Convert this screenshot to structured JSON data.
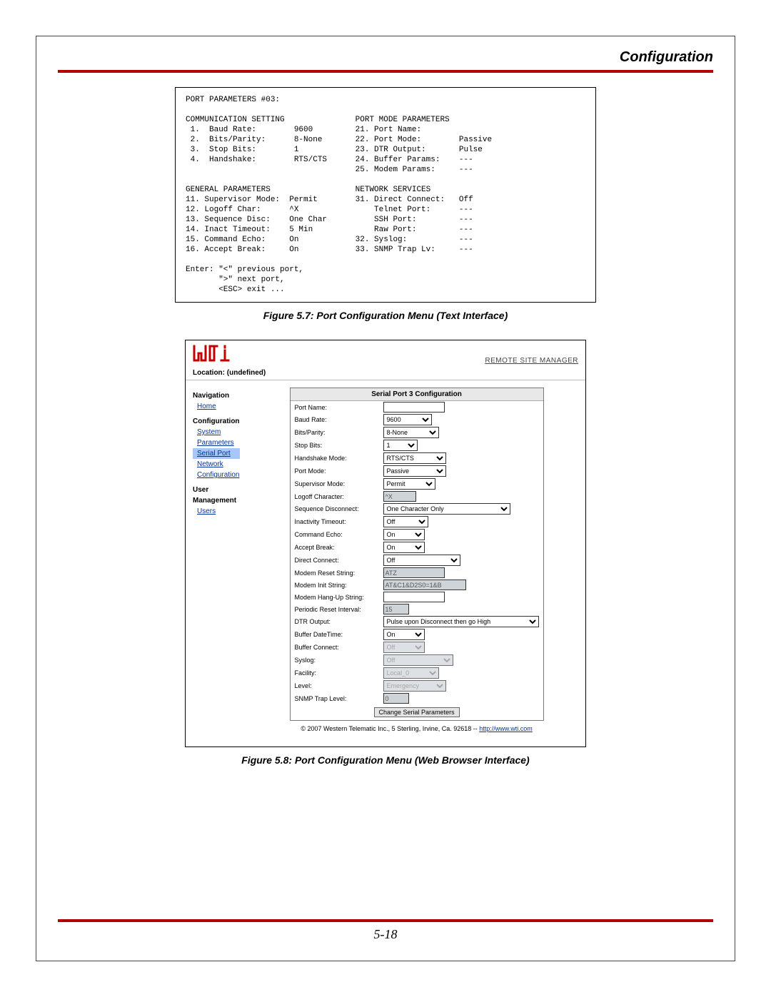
{
  "page": {
    "header": "Configuration",
    "page_number": "5-18"
  },
  "figure7": {
    "caption": "Figure 5.7:  Port Configuration Menu (Text Interface)",
    "title": "PORT PARAMETERS #03:",
    "communication_setting": {
      "heading": "COMMUNICATION SETTING",
      "items": [
        {
          "num": "1.",
          "label": "Baud Rate:",
          "value": "9600"
        },
        {
          "num": "2.",
          "label": "Bits/Parity:",
          "value": "8-None"
        },
        {
          "num": "3.",
          "label": "Stop Bits:",
          "value": "1"
        },
        {
          "num": "4.",
          "label": "Handshake:",
          "value": "RTS/CTS"
        }
      ]
    },
    "port_mode_parameters": {
      "heading": "PORT MODE PARAMETERS",
      "items": [
        {
          "num": "21.",
          "label": "Port Name:",
          "value": ""
        },
        {
          "num": "22.",
          "label": "Port Mode:",
          "value": "Passive"
        },
        {
          "num": "23.",
          "label": "DTR Output:",
          "value": "Pulse"
        },
        {
          "num": "24.",
          "label": "Buffer Params:",
          "value": "---"
        },
        {
          "num": "25.",
          "label": "Modem Params:",
          "value": "---"
        }
      ]
    },
    "general_parameters": {
      "heading": "GENERAL PARAMETERS",
      "items": [
        {
          "num": "11.",
          "label": "Supervisor Mode:",
          "value": "Permit"
        },
        {
          "num": "12.",
          "label": "Logoff Char:",
          "value": "^X"
        },
        {
          "num": "13.",
          "label": "Sequence Disc:",
          "value": "One Char"
        },
        {
          "num": "14.",
          "label": "Inact Timeout:",
          "value": "5 Min"
        },
        {
          "num": "15.",
          "label": "Command Echo:",
          "value": "On"
        },
        {
          "num": "16.",
          "label": "Accept Break:",
          "value": "On"
        }
      ]
    },
    "network_services": {
      "heading": "NETWORK SERVICES",
      "items": [
        {
          "num": "31.",
          "label": "Direct Connect:",
          "value": "Off"
        },
        {
          "num": "",
          "label": "Telnet Port:",
          "value": "---"
        },
        {
          "num": "",
          "label": "SSH Port:",
          "value": "---"
        },
        {
          "num": "",
          "label": "Raw Port:",
          "value": "---"
        },
        {
          "num": "32.",
          "label": "Syslog:",
          "value": "---"
        },
        {
          "num": "33.",
          "label": "SNMP Trap Lv:",
          "value": "---"
        }
      ]
    },
    "footer_lines": [
      "Enter: \"<\" previous port,",
      "       \">\" next port,",
      "       <ESC> exit ..."
    ]
  },
  "figure8": {
    "caption": "Figure 5.8:  Port Configuration Menu (Web Browser Interface)",
    "remote_site_manager": "REMOTE SITE MANAGER",
    "location_label": "Location: (undefined)",
    "nav": {
      "navigation_heading": "Navigation",
      "home": "Home",
      "config_heading": "Configuration",
      "system_parameters": "System Parameters",
      "serial_port": "Serial Port",
      "network_configuration": "Network Configuration",
      "user_mgmt_heading": "User Management",
      "users": "Users"
    },
    "formtitle": "Serial Port 3 Configuration",
    "fields": {
      "port_name": {
        "label": "Port Name:",
        "value": ""
      },
      "baud_rate": {
        "label": "Baud Rate:",
        "value": "9600"
      },
      "bits_parity": {
        "label": "Bits/Parity:",
        "value": "8-None"
      },
      "stop_bits": {
        "label": "Stop Bits:",
        "value": "1"
      },
      "handshake": {
        "label": "Handshake Mode:",
        "value": "RTS/CTS"
      },
      "port_mode": {
        "label": "Port Mode:",
        "value": "Passive"
      },
      "supervisor_mode": {
        "label": "Supervisor Mode:",
        "value": "Permit"
      },
      "logoff_char": {
        "label": "Logoff Character:",
        "value": "^X"
      },
      "sequence_disconnect": {
        "label": "Sequence Disconnect:",
        "value": "One Character Only"
      },
      "inactivity_timeout": {
        "label": "Inactivity Timeout:",
        "value": "Off"
      },
      "command_echo": {
        "label": "Command Echo:",
        "value": "On"
      },
      "accept_break": {
        "label": "Accept Break:",
        "value": "On"
      },
      "direct_connect": {
        "label": "Direct Connect:",
        "value": "Off"
      },
      "modem_reset": {
        "label": "Modem Reset String:",
        "value": "ATZ"
      },
      "modem_init": {
        "label": "Modem Init String:",
        "value": "AT&C1&D2S0=1&B"
      },
      "modem_hangup": {
        "label": "Modem Hang-Up String:",
        "value": ""
      },
      "periodic_reset": {
        "label": "Periodic Reset Interval:",
        "value": "15"
      },
      "dtr_output": {
        "label": "DTR Output:",
        "value": "Pulse upon Disconnect then go High"
      },
      "buffer_datetime": {
        "label": "Buffer DateTime:",
        "value": "On"
      },
      "buffer_connect": {
        "label": "Buffer Connect:",
        "value": "Off"
      },
      "syslog": {
        "label": "Syslog:",
        "value": "Off"
      },
      "facility": {
        "label": "Facility:",
        "value": "Local_0"
      },
      "level": {
        "label": "Level:",
        "value": "Emergency"
      },
      "snmp_trap": {
        "label": "SNMP Trap Level:",
        "value": "0"
      }
    },
    "submit_label": "Change Serial Parameters",
    "footer_text": "© 2007 Western Telematic Inc., 5 Sterling, Irvine, Ca. 92618 -- ",
    "footer_link": "http://www.wti.com"
  }
}
